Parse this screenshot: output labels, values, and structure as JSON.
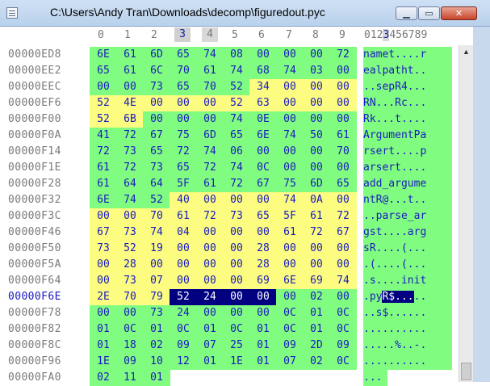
{
  "window": {
    "title": "C:\\Users\\Andy Tran\\Downloads\\decomp\\figuredout.pyc",
    "minimize_label": "▁",
    "maximize_label": "▭",
    "close_label": "✕"
  },
  "columns": [
    "0",
    "1",
    "2",
    "3",
    "4",
    "5",
    "6",
    "7",
    "8",
    "9"
  ],
  "ascii_header": "0123456789",
  "ascii_header_current": "3",
  "current_row": "00000F6E",
  "rows": [
    {
      "addr": "00000ED8",
      "bytes": [
        "6E",
        "61",
        "6D",
        "65",
        "74",
        "08",
        "00",
        "00",
        "00",
        "72"
      ],
      "colors": "gggggggggg",
      "ascii": "namet....r"
    },
    {
      "addr": "00000EE2",
      "bytes": [
        "65",
        "61",
        "6C",
        "70",
        "61",
        "74",
        "68",
        "74",
        "03",
        "00"
      ],
      "colors": "gggggggggg",
      "ascii": "ealpatht.."
    },
    {
      "addr": "00000EEC",
      "bytes": [
        "00",
        "00",
        "73",
        "65",
        "70",
        "52",
        "34",
        "00",
        "00",
        "00"
      ],
      "colors": "ggggggyyyy",
      "ascii": "..sepR4..."
    },
    {
      "addr": "00000EF6",
      "bytes": [
        "52",
        "4E",
        "00",
        "00",
        "00",
        "52",
        "63",
        "00",
        "00",
        "00"
      ],
      "colors": "yyyyyyyyyy",
      "ascii": "RN...Rc..."
    },
    {
      "addr": "00000F00",
      "bytes": [
        "52",
        "6B",
        "00",
        "00",
        "00",
        "74",
        "0E",
        "00",
        "00",
        "00"
      ],
      "colors": "yygggggggg",
      "ascii": "Rk...t...."
    },
    {
      "addr": "00000F0A",
      "bytes": [
        "41",
        "72",
        "67",
        "75",
        "6D",
        "65",
        "6E",
        "74",
        "50",
        "61"
      ],
      "colors": "gggggggggg",
      "ascii": "ArgumentPa"
    },
    {
      "addr": "00000F14",
      "bytes": [
        "72",
        "73",
        "65",
        "72",
        "74",
        "06",
        "00",
        "00",
        "00",
        "70"
      ],
      "colors": "gggggggggg",
      "ascii": "rsert....p"
    },
    {
      "addr": "00000F1E",
      "bytes": [
        "61",
        "72",
        "73",
        "65",
        "72",
        "74",
        "0C",
        "00",
        "00",
        "00"
      ],
      "colors": "gggggggggg",
      "ascii": "arsert...."
    },
    {
      "addr": "00000F28",
      "bytes": [
        "61",
        "64",
        "64",
        "5F",
        "61",
        "72",
        "67",
        "75",
        "6D",
        "65"
      ],
      "colors": "gggggggggg",
      "ascii": "add_argume"
    },
    {
      "addr": "00000F32",
      "bytes": [
        "6E",
        "74",
        "52",
        "40",
        "00",
        "00",
        "00",
        "74",
        "0A",
        "00"
      ],
      "colors": "gggyyyyyyy",
      "ascii": "ntR@...t.."
    },
    {
      "addr": "00000F3C",
      "bytes": [
        "00",
        "00",
        "70",
        "61",
        "72",
        "73",
        "65",
        "5F",
        "61",
        "72"
      ],
      "colors": "yyyyyyyyyy",
      "ascii": "..parse_ar"
    },
    {
      "addr": "00000F46",
      "bytes": [
        "67",
        "73",
        "74",
        "04",
        "00",
        "00",
        "00",
        "61",
        "72",
        "67"
      ],
      "colors": "yyyyyyyyyy",
      "ascii": "gst....arg"
    },
    {
      "addr": "00000F50",
      "bytes": [
        "73",
        "52",
        "19",
        "00",
        "00",
        "00",
        "28",
        "00",
        "00",
        "00"
      ],
      "colors": "yyyyyyyyyy",
      "ascii": "sR....(..."
    },
    {
      "addr": "00000F5A",
      "bytes": [
        "00",
        "28",
        "00",
        "00",
        "00",
        "00",
        "28",
        "00",
        "00",
        "00"
      ],
      "colors": "yyyyyyyyyy",
      "ascii": ".(....(..."
    },
    {
      "addr": "00000F64",
      "bytes": [
        "00",
        "73",
        "07",
        "00",
        "00",
        "00",
        "69",
        "6E",
        "69",
        "74"
      ],
      "colors": "yyyyyyyyyy",
      "ascii": ".s....init"
    },
    {
      "addr": "00000F6E",
      "bytes": [
        "2E",
        "70",
        "79",
        "52",
        "24",
        "00",
        "00",
        "00",
        "02",
        "00"
      ],
      "colors": "yyyssssggg",
      "ascii": ".pyR$....."
    },
    {
      "addr": "00000F78",
      "bytes": [
        "00",
        "00",
        "73",
        "24",
        "00",
        "00",
        "00",
        "0C",
        "01",
        "0C"
      ],
      "colors": "gggggggggg",
      "ascii": "..s$......"
    },
    {
      "addr": "00000F82",
      "bytes": [
        "01",
        "0C",
        "01",
        "0C",
        "01",
        "0C",
        "01",
        "0C",
        "01",
        "0C"
      ],
      "colors": "gggggggggg",
      "ascii": ".........."
    },
    {
      "addr": "00000F8C",
      "bytes": [
        "01",
        "18",
        "02",
        "09",
        "07",
        "25",
        "01",
        "09",
        "2D",
        "09"
      ],
      "colors": "gggggggggg",
      "ascii": ".....%..-."
    },
    {
      "addr": "00000F96",
      "bytes": [
        "1E",
        "09",
        "10",
        "12",
        "01",
        "1E",
        "01",
        "07",
        "02",
        "0C"
      ],
      "colors": "gggggggggg",
      "ascii": ".........."
    },
    {
      "addr": "00000FA0",
      "bytes": [
        "02",
        "11",
        "01",
        "",
        "",
        "",
        "",
        "",
        "",
        ""
      ],
      "colors": "gggeeeeeee",
      "ascii": "..."
    }
  ],
  "selection": {
    "row": "00000F6E",
    "ascii_pre": ".py",
    "ascii_sel": "R$...",
    "ascii_post": ".."
  },
  "colors": {
    "green": "#80fc80",
    "yellow": "#fcfc80",
    "selection": "#000080",
    "hex_text": "#1a1ac0",
    "addr_text": "#7a7a7a"
  }
}
